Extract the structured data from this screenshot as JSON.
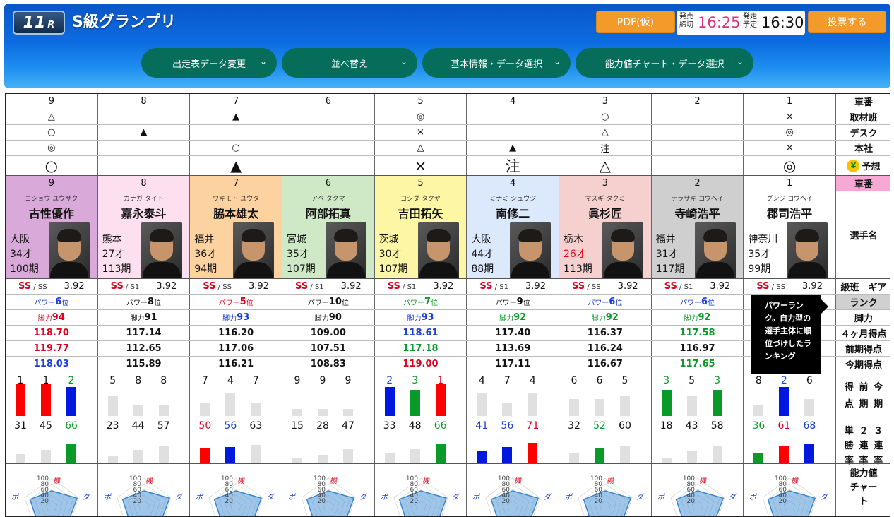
{
  "header": {
    "race_no": "11",
    "race_suffix": "R",
    "title": "S級グランプリ",
    "pdf_label": "PDF(仮)",
    "deadline_label": "発売締切",
    "deadline_time": "16:25",
    "start_label": "発走予定",
    "start_time": "16:30",
    "vote_label": "投票する",
    "deadline_color": "#e0337a"
  },
  "menu": [
    {
      "label": "出走表データ変更"
    },
    {
      "label": "並べ替え"
    },
    {
      "label": "基本情報・データ選択"
    },
    {
      "label": "能力値チャート・データ選択"
    }
  ],
  "row_labels": {
    "car_no": "車番",
    "shuzai": "取材班",
    "desk": "デスク",
    "honsha": "本社",
    "yoso": "予想",
    "yoso_icon": "¥",
    "car_no2": "車番",
    "player": "選手名",
    "class_gear": "級班　ギア",
    "rank": "ランク",
    "kyakuryoku": "脚力",
    "avg4": "４ヶ月得点",
    "prev": "前期得点",
    "curr": "今期得点",
    "pts_periods": [
      "得",
      "点",
      "前",
      "期",
      "今",
      "期"
    ],
    "rates": [
      "単",
      "勝",
      "率",
      "２",
      "連",
      "率",
      "３",
      "連",
      "率"
    ],
    "chart": "能力値チャート",
    "chart_sub": "機動力"
  },
  "racers": [
    {
      "car": "9",
      "shuzai": "△",
      "desk": "○",
      "honsha": "◎",
      "yoso": "○",
      "color": "#d9a9d9",
      "kana": "コショウ ユウサク",
      "name": "古性優作",
      "pref": "大阪",
      "age": "34才",
      "age_red": false,
      "term": "100期",
      "class": "SS",
      "sub": "SS",
      "gear": "3.92",
      "rank_lbl": "パワー",
      "rank": "6",
      "rank_color": "#1a3ed8",
      "kyaku": "94",
      "kyaku_color": "#e0001a",
      "avg4": "118.70",
      "avg4_color": "#e0001a",
      "prev": "119.77",
      "prev_color": "#e0001a",
      "curr": "118.03",
      "curr_color": "#1a3ed8",
      "pts": [
        1,
        1,
        2
      ],
      "pts_colors": [
        "#ff0000",
        "#ff0000",
        "#0018e0"
      ],
      "rates": [
        31,
        45,
        66
      ],
      "rate_colors": [
        "#111",
        "#111",
        "#0a9a28"
      ],
      "rate_bar_colors": [
        "#e0e0e0",
        "#e0e0e0",
        "#0a9a28"
      ],
      "label_colors": [
        "#111",
        "#111",
        "#0a9a28"
      ]
    },
    {
      "car": "8",
      "shuzai": "",
      "desk": "▲",
      "honsha": "",
      "yoso": "",
      "color": "#fde0f0",
      "kana": "カナガ タイト",
      "name": "嘉永泰斗",
      "pref": "熊本",
      "age": "27才",
      "age_red": false,
      "term": "113期",
      "class": "SS",
      "sub": "S1",
      "gear": "3.92",
      "rank_lbl": "パワー",
      "rank": "8",
      "rank_color": "#111",
      "kyaku": "91",
      "kyaku_color": "#111",
      "avg4": "117.14",
      "avg4_color": "#111",
      "prev": "112.65",
      "prev_color": "#111",
      "curr": "115.89",
      "curr_color": "#111",
      "pts": [
        5,
        8,
        8
      ],
      "pts_colors": [
        "#e0e0e0",
        "#e0e0e0",
        "#e0e0e0"
      ],
      "rates": [
        23,
        44,
        57
      ],
      "rate_colors": [
        "#111",
        "#111",
        "#111"
      ],
      "rate_bar_colors": [
        "#e0e0e0",
        "#e0e0e0",
        "#e0e0e0"
      ],
      "label_colors": [
        "#111",
        "#111",
        "#111"
      ]
    },
    {
      "car": "7",
      "shuzai": "▲",
      "desk": "",
      "honsha": "○",
      "yoso": "▲",
      "color": "#fcd3a0",
      "kana": "ワキモト ユウタ",
      "name": "脇本雄太",
      "pref": "福井",
      "age": "36才",
      "age_red": false,
      "term": "94期",
      "class": "SS",
      "sub": "SS",
      "gear": "3.92",
      "rank_lbl": "パワー",
      "rank": "5",
      "rank_color": "#e0001a",
      "kyaku": "93",
      "kyaku_color": "#1a3ed8",
      "avg4": "116.20",
      "avg4_color": "#111",
      "prev": "117.06",
      "prev_color": "#111",
      "curr": "116.21",
      "curr_color": "#111",
      "pts": [
        7,
        4,
        7
      ],
      "pts_colors": [
        "#e0e0e0",
        "#e0e0e0",
        "#e0e0e0"
      ],
      "rates": [
        50,
        56,
        63
      ],
      "rate_colors": [
        "#e0001a",
        "#1a3ed8",
        "#111"
      ],
      "rate_bar_colors": [
        "#ff0000",
        "#0018e0",
        "#e0e0e0"
      ],
      "label_colors": [
        "#111",
        "#111",
        "#111"
      ]
    },
    {
      "car": "6",
      "shuzai": "",
      "desk": "",
      "honsha": "",
      "yoso": "",
      "color": "#cfe8c6",
      "kana": "アベ タクマ",
      "name": "阿部拓真",
      "pref": "宮城",
      "age": "35才",
      "age_red": false,
      "term": "107期",
      "class": "SS",
      "sub": "S1",
      "gear": "3.92",
      "rank_lbl": "パワー",
      "rank": "10",
      "rank_color": "#111",
      "kyaku": "90",
      "kyaku_color": "#111",
      "avg4": "109.00",
      "avg4_color": "#111",
      "prev": "107.51",
      "prev_color": "#111",
      "curr": "108.83",
      "curr_color": "#111",
      "pts": [
        9,
        9,
        9
      ],
      "pts_colors": [
        "#e0e0e0",
        "#e0e0e0",
        "#e0e0e0"
      ],
      "rates": [
        15,
        28,
        47
      ],
      "rate_colors": [
        "#111",
        "#111",
        "#111"
      ],
      "rate_bar_colors": [
        "#e0e0e0",
        "#e0e0e0",
        "#e0e0e0"
      ],
      "label_colors": [
        "#111",
        "#111",
        "#111"
      ]
    },
    {
      "car": "5",
      "shuzai": "◎",
      "desk": "×",
      "honsha": "△",
      "yoso": "×",
      "color": "#fdf6a5",
      "kana": "ヨシダ タクヤ",
      "name": "吉田拓矢",
      "pref": "茨城",
      "age": "30才",
      "age_red": false,
      "term": "107期",
      "class": "SS",
      "sub": "S1",
      "gear": "3.92",
      "rank_lbl": "パワー",
      "rank": "7",
      "rank_color": "#0a9a28",
      "kyaku": "93",
      "kyaku_color": "#1a3ed8",
      "avg4": "118.61",
      "avg4_color": "#1a3ed8",
      "prev": "117.18",
      "prev_color": "#0a9a28",
      "curr": "119.00",
      "curr_color": "#e0001a",
      "pts": [
        2,
        3,
        1
      ],
      "pts_colors": [
        "#0018e0",
        "#0a9a28",
        "#ff0000"
      ],
      "rates": [
        33,
        48,
        66
      ],
      "rate_colors": [
        "#111",
        "#111",
        "#0a9a28"
      ],
      "rate_bar_colors": [
        "#e0e0e0",
        "#e0e0e0",
        "#0a9a28"
      ],
      "label_colors": [
        "#1a3ed8",
        "#0a9a28",
        "#e0001a"
      ]
    },
    {
      "car": "4",
      "shuzai": "",
      "desk": "",
      "honsha": "▲",
      "yoso": "注",
      "color": "#dce8fb",
      "kana": "ミナミ シュウジ",
      "name": "南修二",
      "pref": "大阪",
      "age": "44才",
      "age_red": false,
      "term": "88期",
      "class": "SS",
      "sub": "S1",
      "gear": "3.92",
      "rank_lbl": "パワー",
      "rank": "9",
      "rank_color": "#111",
      "kyaku": "92",
      "kyaku_color": "#0a9a28",
      "avg4": "117.40",
      "avg4_color": "#111",
      "prev": "113.69",
      "prev_color": "#111",
      "curr": "117.11",
      "curr_color": "#111",
      "pts": [
        4,
        7,
        4
      ],
      "pts_colors": [
        "#e0e0e0",
        "#e0e0e0",
        "#e0e0e0"
      ],
      "rates": [
        41,
        56,
        71
      ],
      "rate_colors": [
        "#1a3ed8",
        "#1a3ed8",
        "#e0001a"
      ],
      "rate_bar_colors": [
        "#0018e0",
        "#0018e0",
        "#ff0000"
      ],
      "label_colors": [
        "#111",
        "#111",
        "#111"
      ]
    },
    {
      "car": "3",
      "shuzai": "○",
      "desk": "△",
      "honsha": "注",
      "yoso": "△",
      "color": "#f6cfcf",
      "kana": "マスギ タクミ",
      "name": "眞杉匠",
      "pref": "栃木",
      "age": "26才",
      "age_red": true,
      "term": "113期",
      "class": "SS",
      "sub": "SS",
      "gear": "3.92",
      "rank_lbl": "パワー",
      "rank": "6",
      "rank_color": "#1a3ed8",
      "kyaku": "92",
      "kyaku_color": "#0a9a28",
      "avg4": "116.37",
      "avg4_color": "#111",
      "prev": "116.24",
      "prev_color": "#111",
      "curr": "116.67",
      "curr_color": "#111",
      "pts": [
        6,
        6,
        5
      ],
      "pts_colors": [
        "#e0e0e0",
        "#e0e0e0",
        "#e0e0e0"
      ],
      "rates": [
        32,
        52,
        60
      ],
      "rate_colors": [
        "#111",
        "#0a9a28",
        "#111"
      ],
      "rate_bar_colors": [
        "#e0e0e0",
        "#0a9a28",
        "#e0e0e0"
      ],
      "label_colors": [
        "#111",
        "#111",
        "#111"
      ]
    },
    {
      "car": "2",
      "shuzai": "",
      "desk": "",
      "honsha": "",
      "yoso": "",
      "color": "#cfcfcf",
      "kana": "テラサキ コウヘイ",
      "name": "寺崎浩平",
      "pref": "福井",
      "age": "31才",
      "age_red": false,
      "term": "117期",
      "class": "SS",
      "sub": "S1",
      "gear": "3.92",
      "rank_lbl": "パワー",
      "rank": "6",
      "rank_color": "#1a3ed8",
      "kyaku": "92",
      "kyaku_color": "#0a9a28",
      "avg4": "117.58",
      "avg4_color": "#0a9a28",
      "prev": "116.97",
      "prev_color": "#111",
      "curr": "117.65",
      "curr_color": "#0a9a28",
      "pts": [
        3,
        5,
        3
      ],
      "pts_colors": [
        "#0a9a28",
        "#e0e0e0",
        "#0a9a28"
      ],
      "rates": [
        18,
        43,
        58
      ],
      "rate_colors": [
        "#111",
        "#111",
        "#111"
      ],
      "rate_bar_colors": [
        "#e0e0e0",
        "#e0e0e0",
        "#e0e0e0"
      ],
      "label_colors": [
        "#0a9a28",
        "#111",
        "#0a9a28"
      ]
    },
    {
      "car": "1",
      "shuzai": "×",
      "desk": "◎",
      "honsha": "×",
      "yoso": "◎",
      "color": "#ffffff",
      "kana": "グンジ コウヘイ",
      "name": "郡司浩平",
      "pref": "神奈川",
      "age": "35才",
      "age_red": false,
      "term": "99期",
      "class": "SS",
      "sub": "SS",
      "gear": "3.92",
      "rank_lbl": "",
      "rank": "",
      "rank_color": "#111",
      "kyaku": "",
      "kyaku_color": "#111",
      "avg4": "",
      "avg4_color": "#111",
      "prev": "",
      "prev_color": "#111",
      "curr": "",
      "curr_color": "#111",
      "pts": [
        8,
        2,
        6
      ],
      "pts_colors": [
        "#e0e0e0",
        "#0018e0",
        "#e0e0e0"
      ],
      "rates": [
        36,
        61,
        68
      ],
      "rate_colors": [
        "#0a9a28",
        "#e0001a",
        "#1a3ed8"
      ],
      "rate_bar_colors": [
        "#0a9a28",
        "#ff0000",
        "#0018e0"
      ],
      "label_colors": [
        "#111",
        "#1a3ed8",
        "#111"
      ]
    }
  ],
  "tooltip": "パワーランク。自力型の選手主体に順位づけしたランキング",
  "radar": {
    "scale": [
      "100",
      "80",
      "60",
      "40",
      "20"
    ],
    "top": "機",
    "left": "ポ",
    "right": "ダ"
  }
}
